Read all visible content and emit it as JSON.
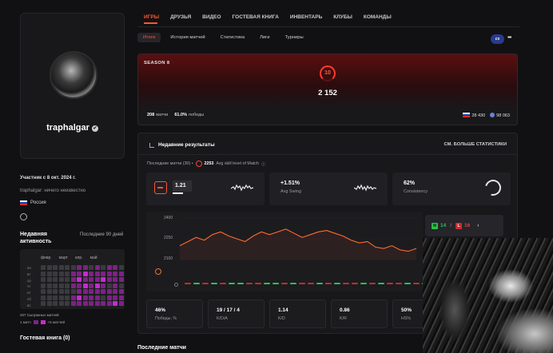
{
  "profile": {
    "username": "traphalgar",
    "verified_icon": "✔",
    "member_since": "Участник с 8 окт. 2024 г.",
    "bio": "traphalgar: ничего неизвестно",
    "country": "Россия"
  },
  "activity": {
    "title": "Недавняя активность",
    "period": "Последние 90 дней",
    "months": [
      "февр.",
      "март",
      "апр.",
      "май"
    ],
    "days": [
      "пн",
      "вт",
      "ср",
      "чт",
      "пт",
      "сб",
      "вс"
    ],
    "played_summary": "207 Сыгранных матчей",
    "legend_low": "1 матч",
    "legend_high": "+5 матчей"
  },
  "guestbook": {
    "title": "Гостевая книга (0)"
  },
  "nav": {
    "items": [
      "ИГРЫ",
      "ДРУЗЬЯ",
      "ВИДЕО",
      "ГОСТЕВАЯ КНИГА",
      "ИНВЕНТАРЬ",
      "КЛУБЫ",
      "КОМАНДЫ"
    ],
    "active_index": 0
  },
  "subtabs": {
    "items": [
      "Итоги",
      "История матчей",
      "Статистика",
      "Лиги",
      "Турниры"
    ],
    "active_index": 0,
    "game_badge": "cs",
    "more_label": "•••"
  },
  "season": {
    "label": "SEASON 8",
    "level": "10",
    "elo": "2 152",
    "matches_value": "208",
    "matches_label": "матчи",
    "winrate_value": "61.0%",
    "winrate_label": "победы",
    "country_rank": "28 430",
    "world_rank": "98 063"
  },
  "results": {
    "title": "Недавние результаты",
    "see_more": "СМ. БОЛЬШЕ СТАТИСТИКИ",
    "last_matches_prefix": "Последние матчи (30) •",
    "avg_elo": "2253",
    "avg_elo_suffix": "Avg skill level of Match",
    "info_icon": "ⓘ",
    "metrics": [
      {
        "value": "1.21",
        "label": ""
      },
      {
        "value": "+1.51%",
        "label": "Avg Swing"
      },
      {
        "value": "62%",
        "label": "Consistency"
      }
    ],
    "chart_ticks": [
      "2400",
      "2250",
      "2100"
    ],
    "wins": "14",
    "losses": "16",
    "sep": "/",
    "arrow": "›",
    "win_letter": "W",
    "loss_letter": "L",
    "stats": [
      {
        "value": "46%",
        "label": "Победы, %"
      },
      {
        "value": "19 / 17 / 4",
        "label": "K/D/A"
      },
      {
        "value": "1.14",
        "label": "K/D"
      },
      {
        "value": "0.86",
        "label": "K/R"
      },
      {
        "value": "50%",
        "label": "HS%"
      }
    ]
  },
  "recent_matches": {
    "title": "Последние матчи"
  },
  "colors": {
    "accent": "#ff5533",
    "win": "#2bc24a",
    "loss": "#c92a2a",
    "activity": "#c52ccf"
  },
  "chart_data": {
    "type": "line",
    "title": "",
    "ylim": [
      2100,
      2400
    ],
    "y": [
      2200,
      2230,
      2260,
      2240,
      2280,
      2300,
      2270,
      2250,
      2230,
      2270,
      2300,
      2280,
      2300,
      2320,
      2290,
      2260,
      2280,
      2300,
      2310,
      2290,
      2270,
      2240,
      2220,
      2230,
      2190,
      2180,
      2200,
      2170,
      2160,
      2180
    ],
    "results": [
      "L",
      "W",
      "L",
      "W",
      "L",
      "W",
      "W",
      "L",
      "L",
      "W",
      "W",
      "L",
      "W",
      "L",
      "L",
      "W",
      "L",
      "W",
      "L",
      "L",
      "W",
      "L",
      "W",
      "L",
      "L",
      "W",
      "L",
      "W",
      "L",
      "W"
    ]
  }
}
